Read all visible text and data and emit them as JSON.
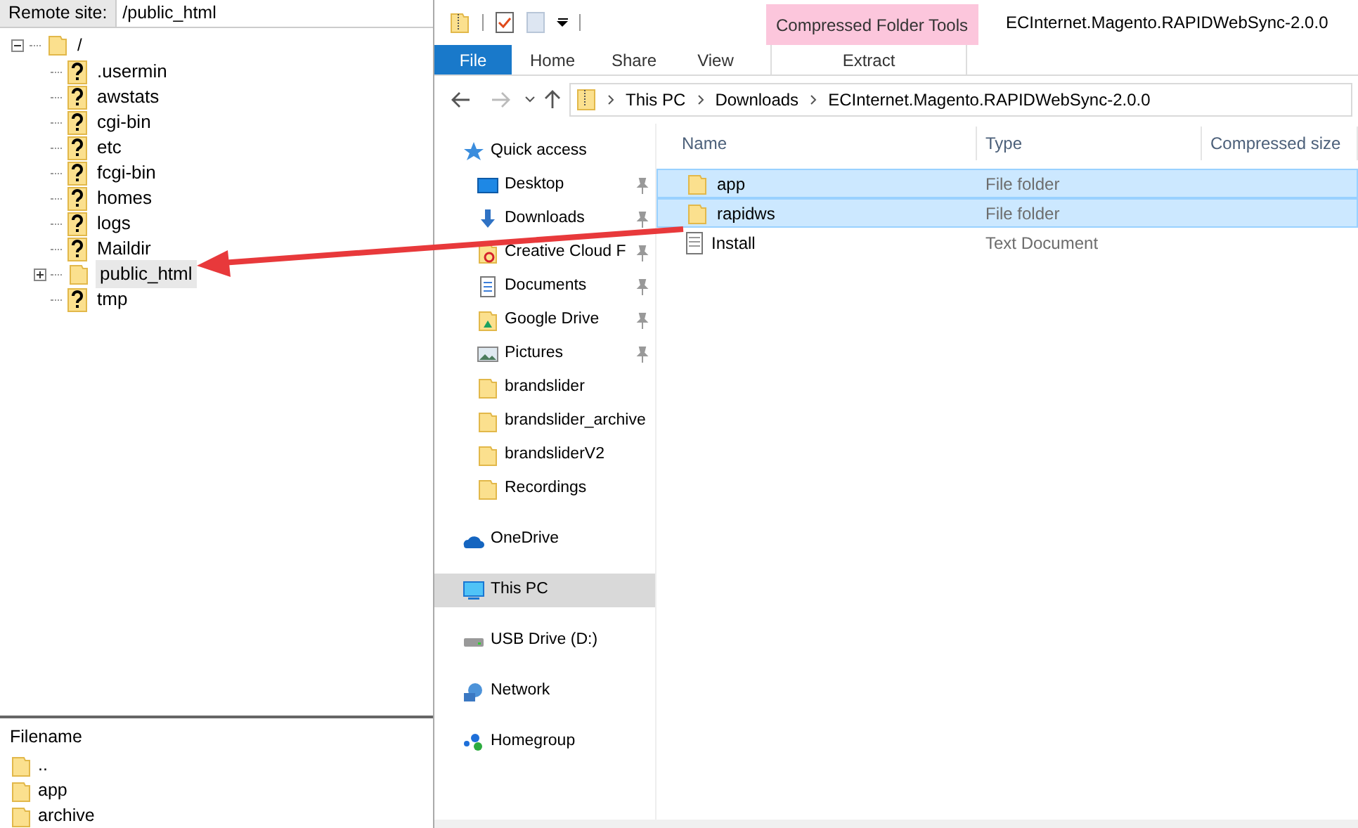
{
  "remote_site": {
    "label": "Remote site:",
    "value": "/public_html"
  },
  "remote_tree": {
    "label": "/",
    "expanded": true,
    "children": [
      {
        "label": ".usermin",
        "kind": "unknown",
        "selected": false,
        "expandable": false
      },
      {
        "label": "awstats",
        "kind": "unknown",
        "selected": false,
        "expandable": false
      },
      {
        "label": "cgi-bin",
        "kind": "unknown",
        "selected": false,
        "expandable": false
      },
      {
        "label": "etc",
        "kind": "unknown",
        "selected": false,
        "expandable": false
      },
      {
        "label": "fcgi-bin",
        "kind": "unknown",
        "selected": false,
        "expandable": false
      },
      {
        "label": "homes",
        "kind": "unknown",
        "selected": false,
        "expandable": false
      },
      {
        "label": "logs",
        "kind": "unknown",
        "selected": false,
        "expandable": false
      },
      {
        "label": "Maildir",
        "kind": "unknown",
        "selected": false,
        "expandable": false
      },
      {
        "label": "public_html",
        "kind": "folder",
        "selected": true,
        "expandable": true
      },
      {
        "label": "tmp",
        "kind": "unknown",
        "selected": false,
        "expandable": false
      }
    ]
  },
  "remote_files": {
    "column": "Filename",
    "rows": [
      {
        "name": ".."
      },
      {
        "name": "app"
      },
      {
        "name": "archive"
      }
    ]
  },
  "explorer": {
    "title": "ECInternet.Magento.RAPIDWebSync-2.0.0",
    "contextual_tab_group": "Compressed Folder Tools",
    "ribbon_tabs": [
      {
        "label": "File",
        "selected": true
      },
      {
        "label": "Home",
        "selected": false
      },
      {
        "label": "Share",
        "selected": false
      },
      {
        "label": "View",
        "selected": false
      },
      {
        "label": "Extract",
        "selected": false
      }
    ],
    "breadcrumb": [
      "This PC",
      "Downloads",
      "ECInternet.Magento.RAPIDWebSync-2.0.0"
    ],
    "nav": [
      {
        "label": "Quick access",
        "kind": "star",
        "selected": false,
        "pinned": false,
        "indent": false
      },
      {
        "label": "Desktop",
        "kind": "desktop",
        "selected": false,
        "pinned": true,
        "indent": true
      },
      {
        "label": "Downloads",
        "kind": "download",
        "selected": false,
        "pinned": true,
        "indent": true
      },
      {
        "label": "Creative Cloud F",
        "kind": "cloud-folder",
        "selected": false,
        "pinned": true,
        "indent": true
      },
      {
        "label": "Documents",
        "kind": "document",
        "selected": false,
        "pinned": true,
        "indent": true
      },
      {
        "label": "Google Drive",
        "kind": "drive-folder",
        "selected": false,
        "pinned": true,
        "indent": true
      },
      {
        "label": "Pictures",
        "kind": "pictures",
        "selected": false,
        "pinned": true,
        "indent": true
      },
      {
        "label": "brandslider",
        "kind": "folder",
        "selected": false,
        "pinned": false,
        "indent": true
      },
      {
        "label": "brandslider_archive",
        "kind": "folder",
        "selected": false,
        "pinned": false,
        "indent": true
      },
      {
        "label": "brandsliderV2",
        "kind": "folder",
        "selected": false,
        "pinned": false,
        "indent": true
      },
      {
        "label": "Recordings",
        "kind": "folder",
        "selected": false,
        "pinned": false,
        "indent": true
      },
      {
        "label": "OneDrive",
        "kind": "onedrive",
        "selected": false,
        "pinned": false,
        "indent": false
      },
      {
        "label": "This PC",
        "kind": "pc",
        "selected": true,
        "pinned": false,
        "indent": false
      },
      {
        "label": "USB Drive (D:)",
        "kind": "usb",
        "selected": false,
        "pinned": false,
        "indent": false
      },
      {
        "label": "Network",
        "kind": "network",
        "selected": false,
        "pinned": false,
        "indent": false
      },
      {
        "label": "Homegroup",
        "kind": "homegroup",
        "selected": false,
        "pinned": false,
        "indent": false
      }
    ],
    "columns": [
      "Name",
      "Type",
      "Compressed size"
    ],
    "files": [
      {
        "name": "app",
        "type": "File folder",
        "kind": "folder",
        "selected": true
      },
      {
        "name": "rapidws",
        "type": "File folder",
        "kind": "folder",
        "selected": true
      },
      {
        "name": "Install",
        "type": "Text Document",
        "kind": "text",
        "selected": false
      }
    ]
  }
}
